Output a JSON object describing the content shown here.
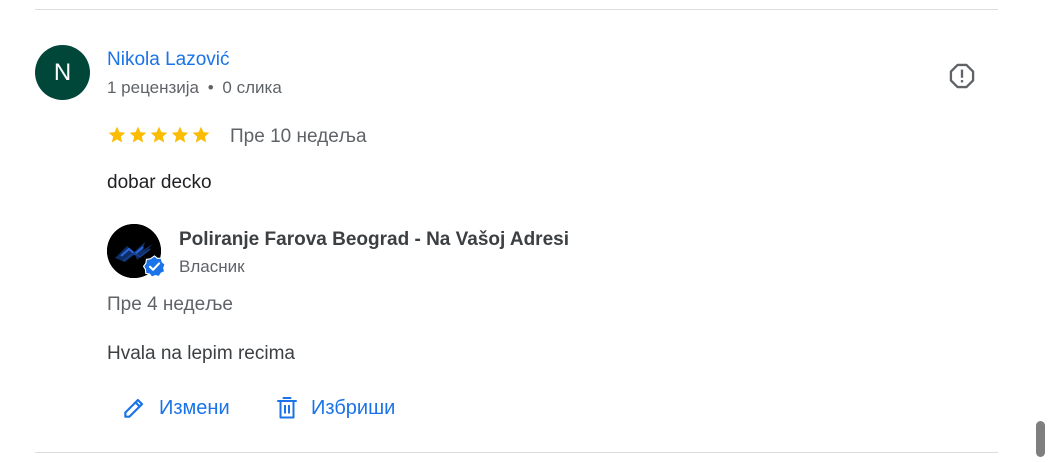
{
  "review": {
    "avatar_initial": "N",
    "avatar_color": "#00473a",
    "reviewer_name": "Nikola Lazović",
    "reviews_count": "1 рецензија",
    "meta_separator": "•",
    "photos_count": "0 слика",
    "rating": 5,
    "rating_max": 5,
    "star_color": "#fbbc04",
    "date": "Пре 10 недеља",
    "text": "dobar decko",
    "report_icon": "report-flag-icon"
  },
  "owner_reply": {
    "avatar_icon": "business-logo-icon",
    "verified_icon": "verified-badge-icon",
    "name": "Poliranje Farova Beograd - Na Vašoj Adresi",
    "role": "Власник",
    "date": "Пре 4 недеље",
    "text": "Hvala na lepim recima"
  },
  "actions": {
    "edit_label": "Измени",
    "edit_icon": "pencil-icon",
    "delete_label": "Избриши",
    "delete_icon": "trash-icon",
    "accent_color": "#1a73e8"
  }
}
